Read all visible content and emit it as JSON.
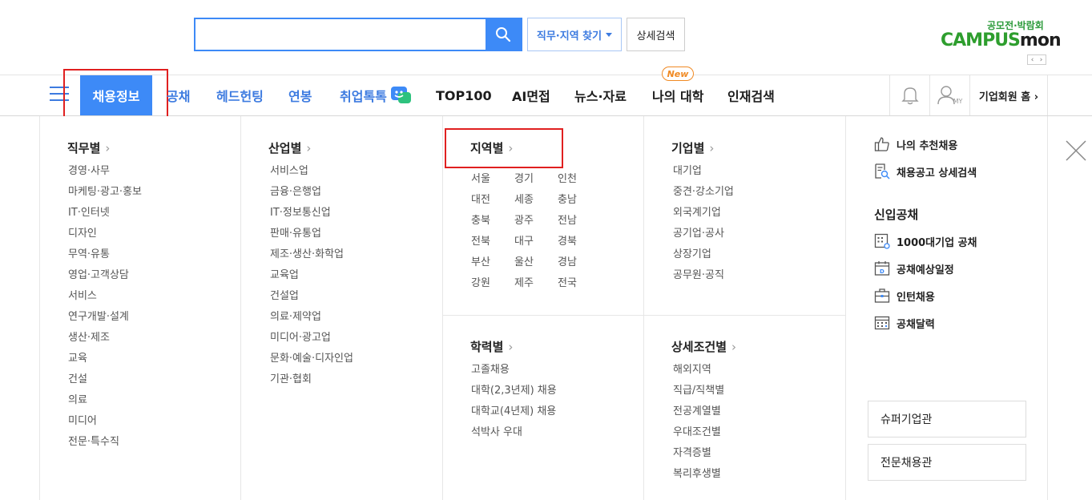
{
  "header": {
    "search_placeholder": "",
    "search_value": "",
    "job_location_btn": "직무·지역 찾기",
    "detail_search_btn": "상세검색",
    "brand_sub": "공모전·박람회",
    "brand_part1": "CAMPUS",
    "brand_part2": "mon",
    "brand_prev": "‹",
    "brand_next": "›"
  },
  "nav": {
    "items": [
      {
        "label": "채용정보"
      },
      {
        "label": "공채"
      },
      {
        "label": "헤드헌팅"
      },
      {
        "label": "연봉"
      },
      {
        "label": "취업톡톡"
      },
      {
        "label": "TOP100"
      },
      {
        "label": "AI면접"
      },
      {
        "label": "뉴스·자료"
      },
      {
        "label": "나의 대학"
      },
      {
        "label": "인재검색"
      }
    ],
    "new_badge": "New",
    "my_label": "MY",
    "corp_home": "기업회원 홈 ›"
  },
  "dropdown": {
    "job": {
      "title": "직무별",
      "items": [
        "경영·사무",
        "마케팅·광고·홍보",
        "IT·인터넷",
        "디자인",
        "무역·유통",
        "영업·고객상담",
        "서비스",
        "연구개발·설계",
        "생산·제조",
        "교육",
        "건설",
        "의료",
        "미디어",
        "전문·특수직"
      ]
    },
    "industry": {
      "title": "산업별",
      "items": [
        "서비스업",
        "금융·은행업",
        "IT·정보통신업",
        "판매·유통업",
        "제조·생산·화학업",
        "교육업",
        "건설업",
        "의료·제약업",
        "미디어·광고업",
        "문화·예술·디자인업",
        "기관·협회"
      ]
    },
    "region": {
      "title": "지역별",
      "items": [
        "서울",
        "경기",
        "인천",
        "대전",
        "세종",
        "충남",
        "충북",
        "광주",
        "전남",
        "전북",
        "대구",
        "경북",
        "부산",
        "울산",
        "경남",
        "강원",
        "제주",
        "전국"
      ]
    },
    "company": {
      "title": "기업별",
      "items": [
        "대기업",
        "중견·강소기업",
        "외국계기업",
        "공기업·공사",
        "상장기업",
        "공무원·공직"
      ]
    },
    "education": {
      "title": "학력별",
      "items": [
        "고졸채용",
        "대학(2,3년제) 채용",
        "대학교(4년제) 채용",
        "석박사 우대"
      ]
    },
    "condition": {
      "title": "상세조건별",
      "items": [
        "해외지역",
        "직급/직책별",
        "전공계열별",
        "우대조건별",
        "자격증별",
        "복리후생별"
      ]
    },
    "side": {
      "recommend": "나의 추천채용",
      "detail_search": "채용공고 상세검색",
      "newgrad_title": "신입공채",
      "top1000": "1000대기업 공채",
      "schedule": "공채예상일정",
      "intern": "인턴채용",
      "calendar": "공채달력",
      "super_corp": "슈퍼기업관",
      "pro_hire": "전문채용관"
    }
  }
}
